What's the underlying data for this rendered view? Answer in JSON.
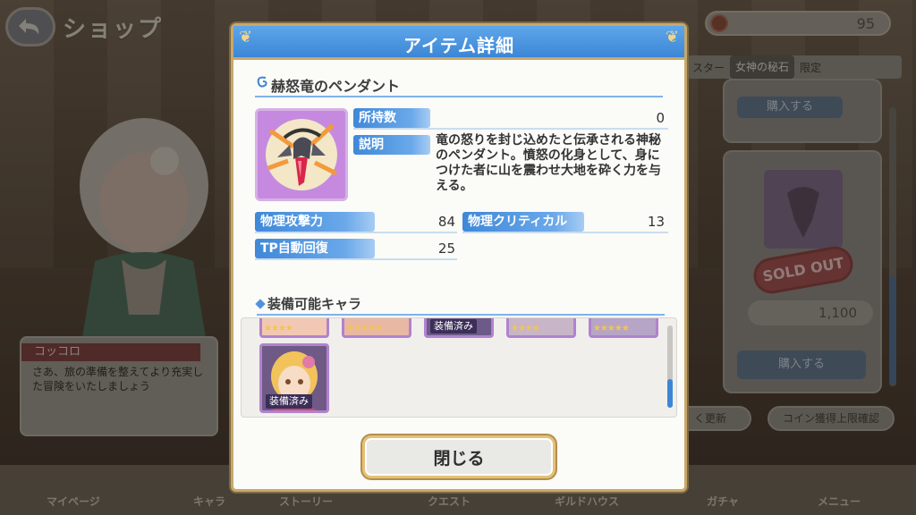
{
  "background": {
    "screen_title": "ショップ",
    "coins": "95",
    "tabs": [
      "スター",
      "女神の秘石",
      "限定"
    ],
    "buy_label_top": "購入する",
    "sold_out": "SOLD OUT",
    "price": "1,100",
    "buy_label_bottom": "購入する",
    "refresh_label": "く更新",
    "coin_limit_label": "コイン獲得上限確認",
    "speech": {
      "name": "コッコロ",
      "text": "さあ、旅の準備を整えてより充実した冒険をいたしましょう"
    },
    "nav": [
      "マイページ",
      "キャラ",
      "ストーリー",
      "クエスト",
      "ギルドハウス",
      "ガチャ",
      "メニュー"
    ]
  },
  "dialog": {
    "title": "アイテム詳細",
    "item_name": "赫怒竜のペンダント",
    "owned_label": "所持数",
    "owned_value": "0",
    "description_label": "説明",
    "description": "竜の怒りを封じ込めたと伝承される神秘のペンダント。憤怒の化身として、身につけた者に山を震わせ大地を砕く力を与える。",
    "stats": [
      {
        "label": "物理攻撃力",
        "value": "84"
      },
      {
        "label": "物理クリティカル",
        "value": "13"
      },
      {
        "label": "TP自動回復",
        "value": "25"
      }
    ],
    "equip_section_title": "装備可能キャラ",
    "equipped_badge": "装備済み",
    "close_label": "閉じる"
  },
  "colors": {
    "header_blue": "#3c86d6",
    "label_blue": "#3f88d8",
    "frame_gold": "#c8a86a",
    "item_frame_purple": "#b77ad0"
  }
}
